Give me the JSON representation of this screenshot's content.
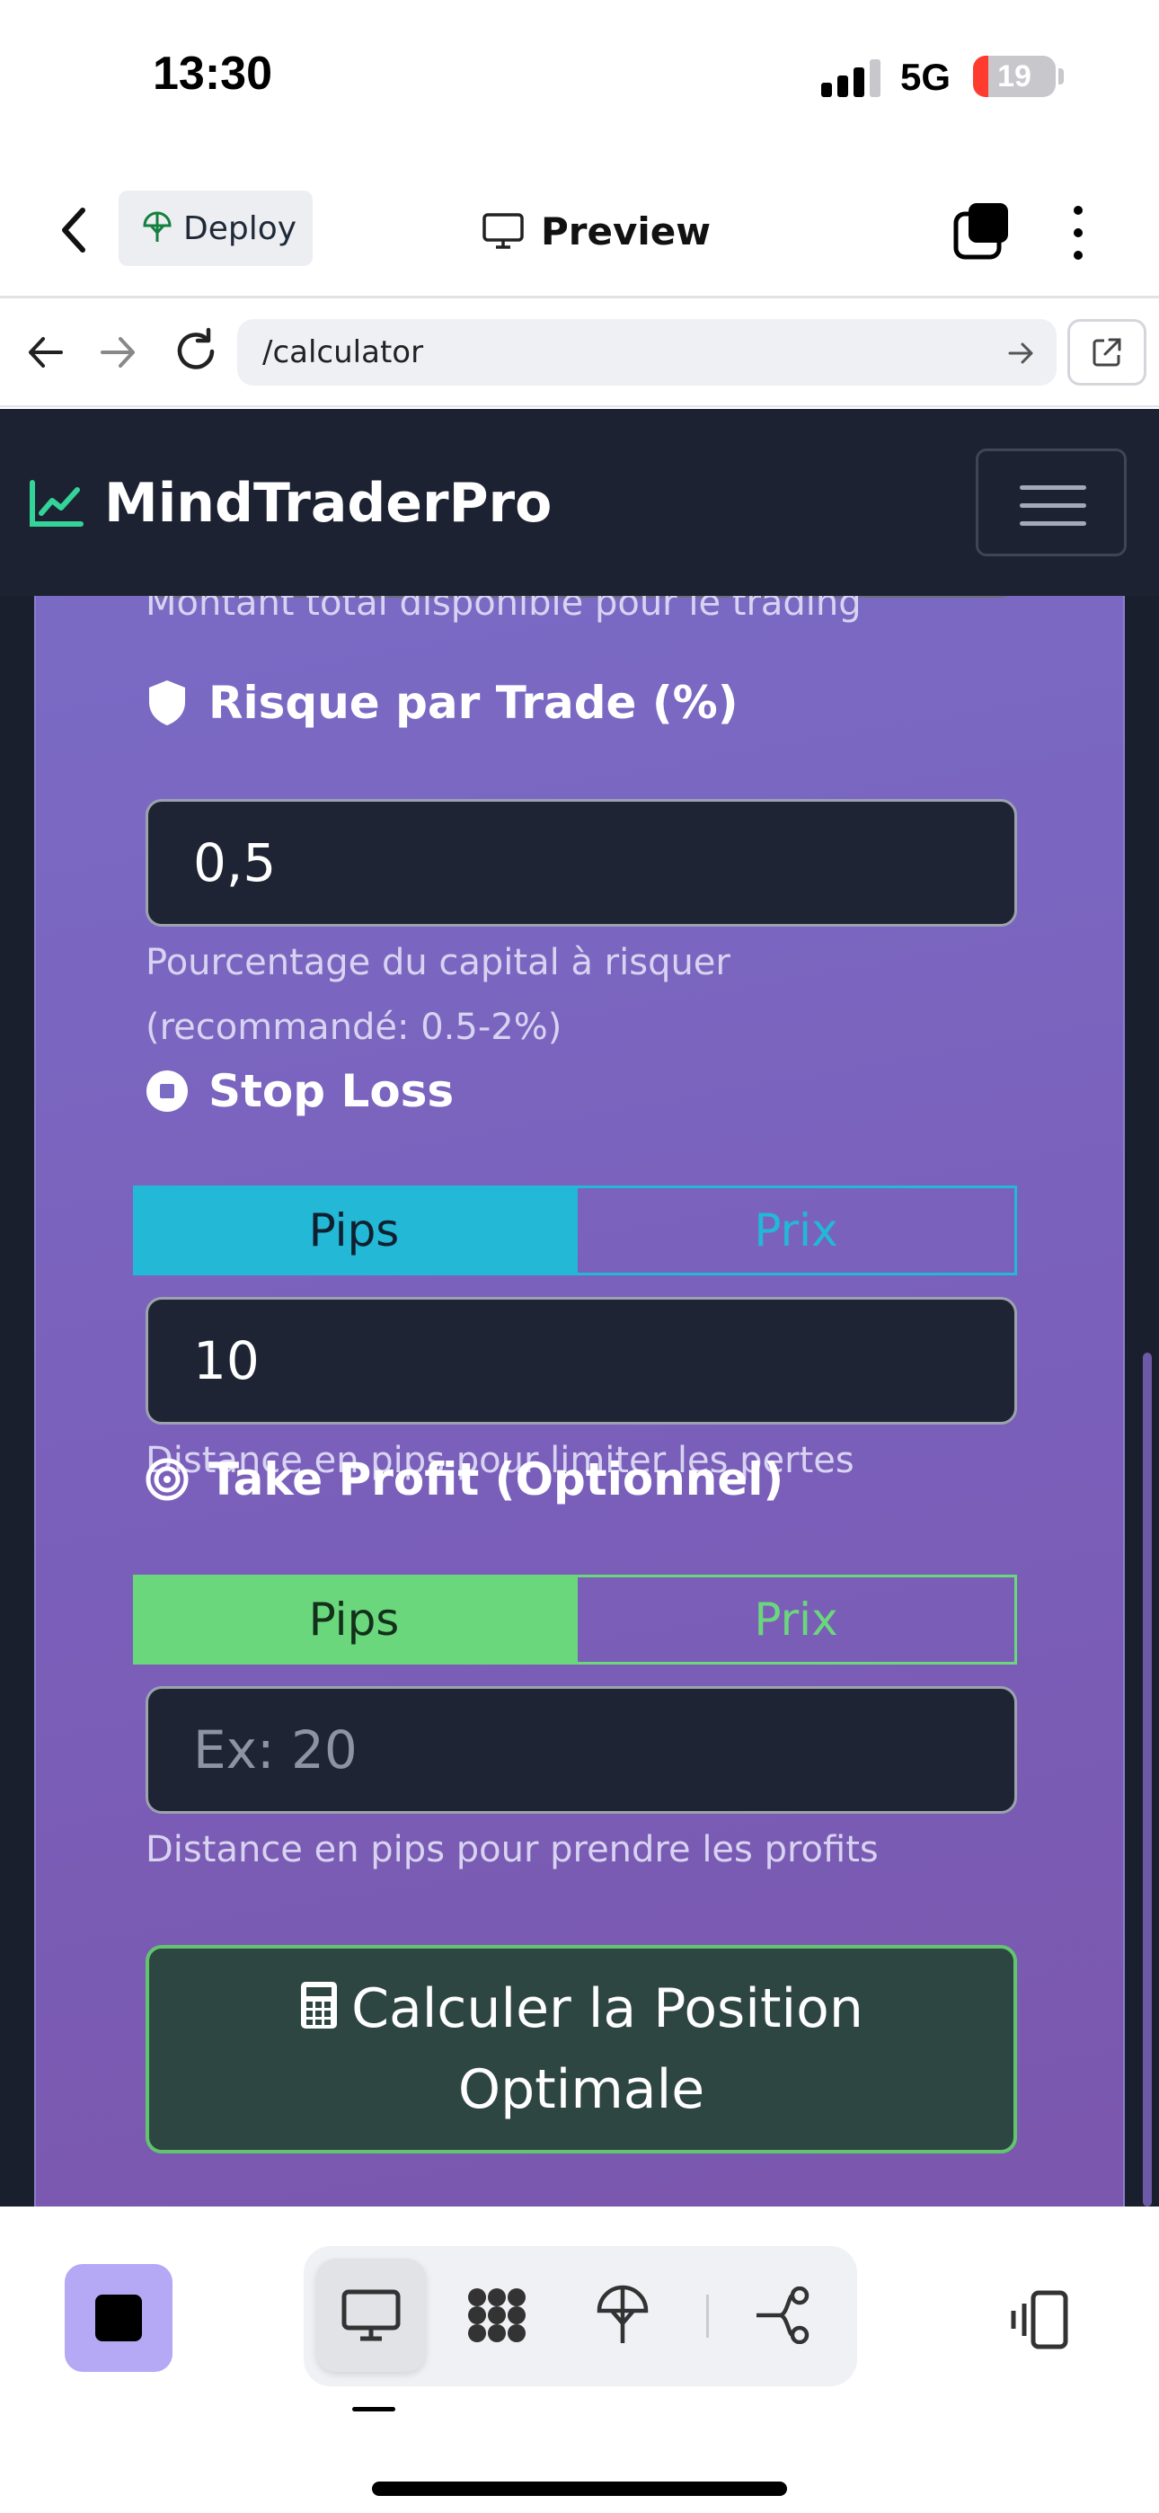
{
  "status_bar": {
    "time": "13:30",
    "network": "5G",
    "battery": "19",
    "battery_level": 0.19
  },
  "app_header": {
    "deploy_label": "Deploy",
    "title": "Preview"
  },
  "browser": {
    "url": "/calculator"
  },
  "site": {
    "brand": "MindTraderPro"
  },
  "form": {
    "capital_help": "Montant total disponible pour le trading",
    "risk": {
      "label": "Risque par Trade (%)",
      "value": "0,5",
      "help_line1": "Pourcentage du capital à risquer",
      "help_line2": "(recommandé: 0.5-2%)"
    },
    "stop_loss": {
      "label": "Stop Loss",
      "toggle_pips": "Pips",
      "toggle_price": "Prix",
      "selected": "Pips",
      "value": "10",
      "help": "Distance en pips pour limiter les pertes"
    },
    "take_profit": {
      "label": "Take Profit (Optionnel)",
      "toggle_pips": "Pips",
      "toggle_price": "Prix",
      "selected": "Pips",
      "placeholder": "Ex: 20",
      "help": "Distance en pips pour prendre les profits"
    },
    "submit_label": "Calculer la Position Optimale"
  },
  "colors": {
    "stop_loss_accent": "#22b8d6",
    "take_profit_accent": "#6bd77d",
    "submit_border": "#62c46f",
    "brand_icon": "#34d399",
    "panel_purple": "#7a5fba"
  },
  "toolbar": {
    "stop": "stop-icon",
    "segments": [
      "monitor-icon",
      "workspace-icon",
      "deploy-icon",
      "git-icon"
    ],
    "active_segment": "monitor-icon",
    "right": "devices-icon"
  }
}
